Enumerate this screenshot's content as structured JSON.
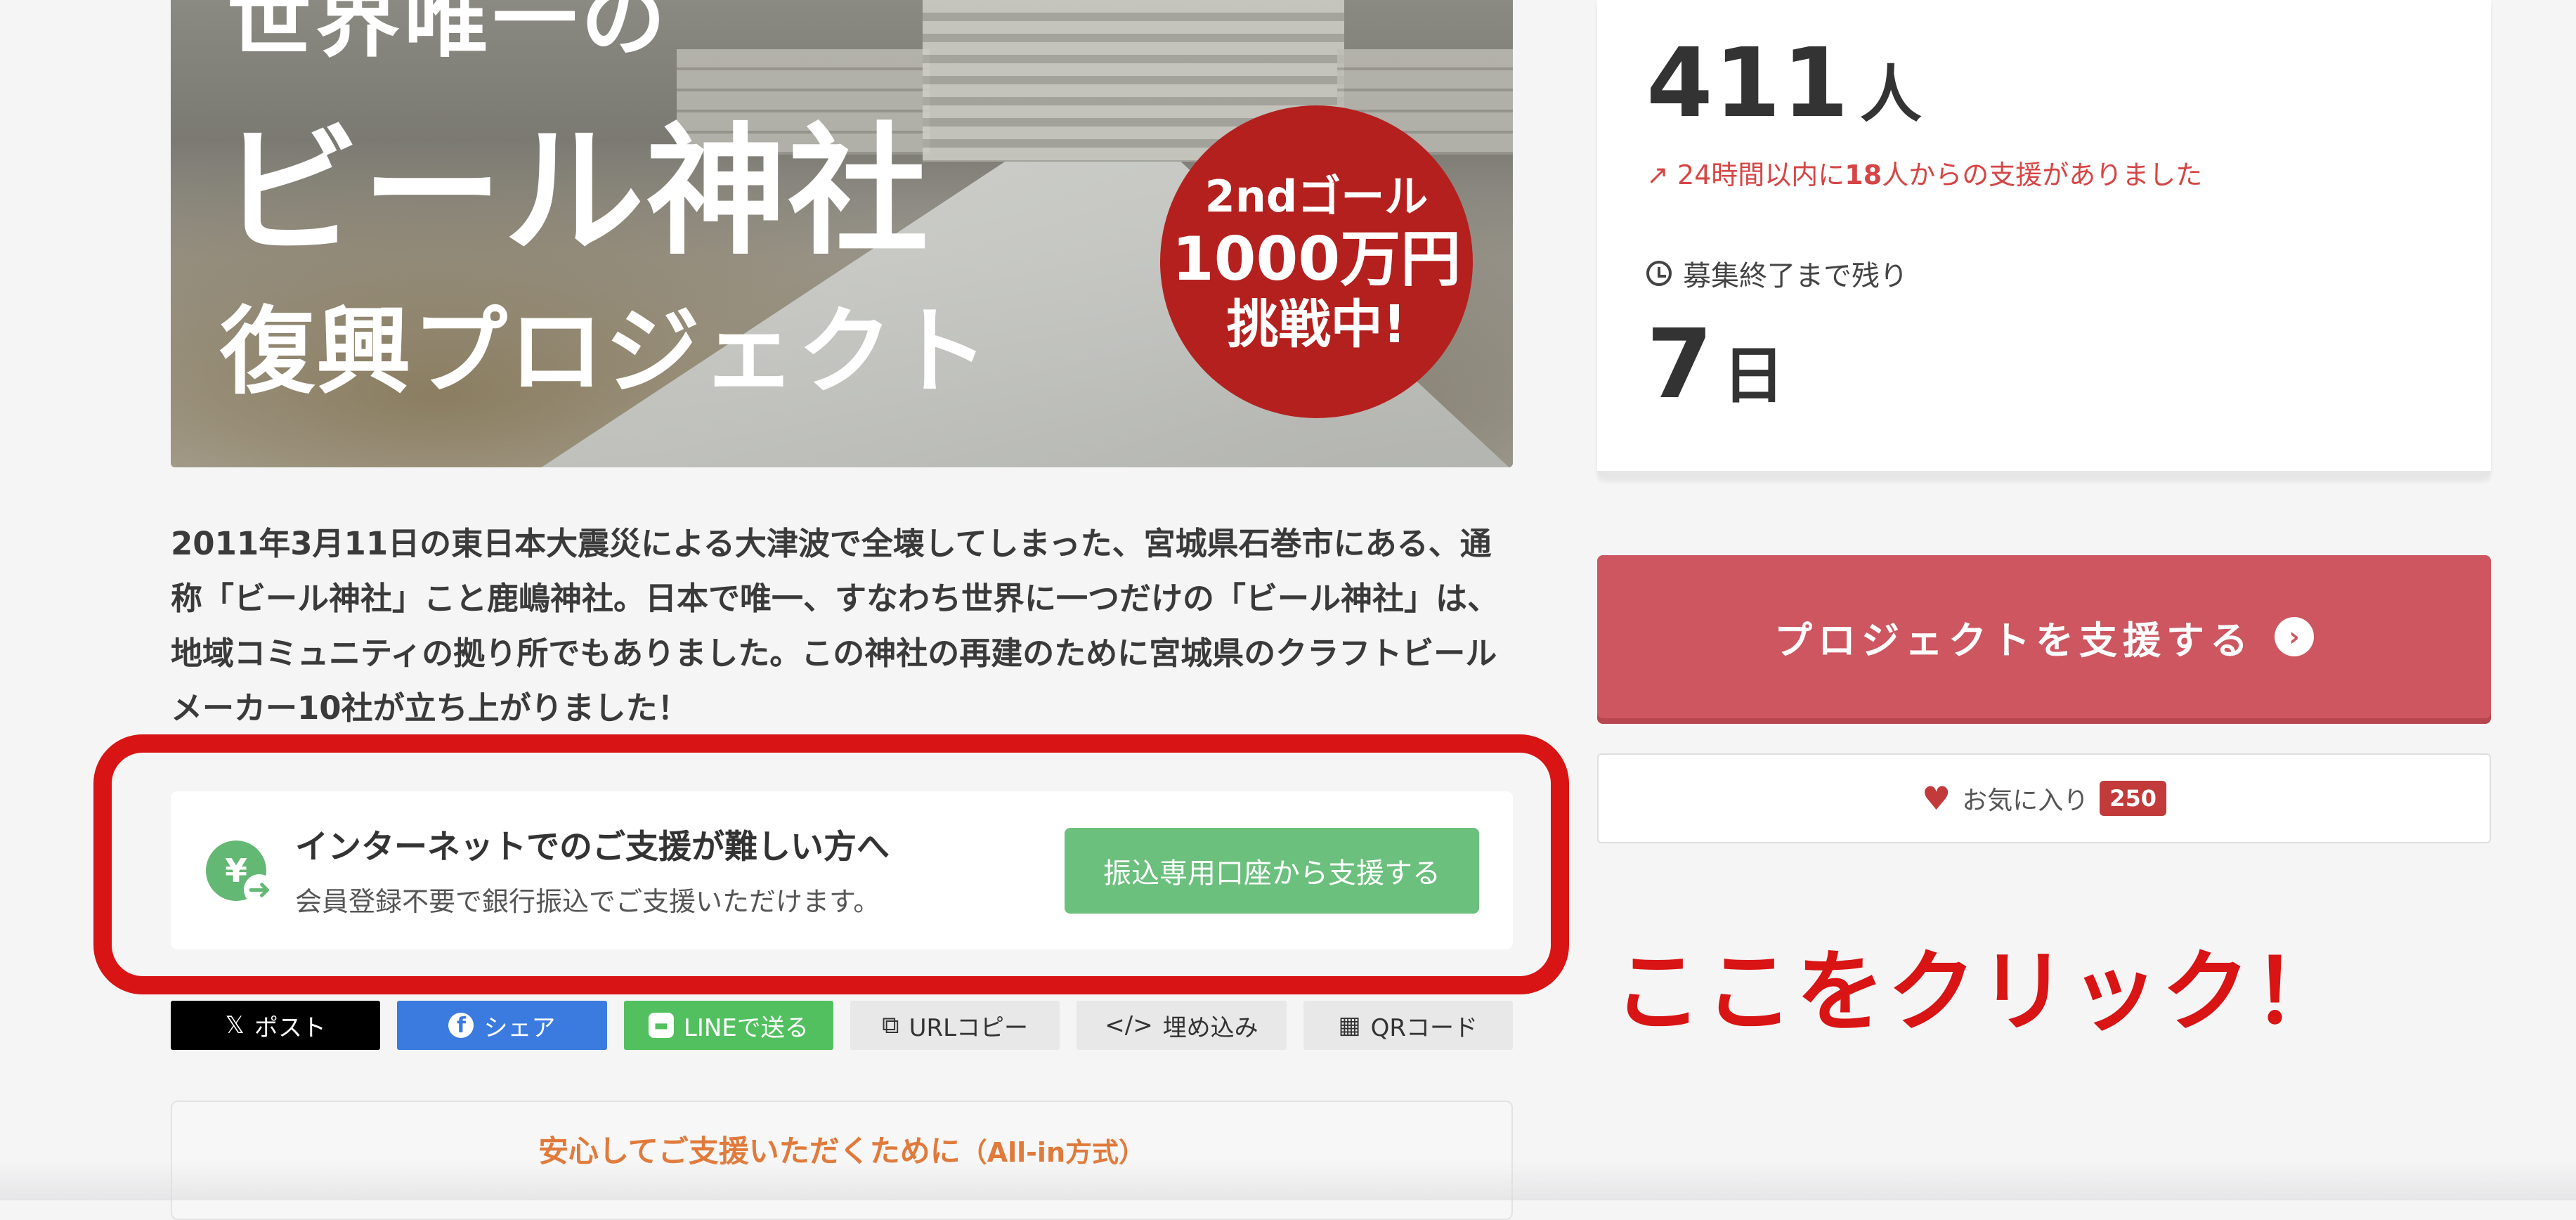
{
  "hero": {
    "title_top": "世界唯一の",
    "title_main": "ビール神社",
    "title_sub": "復興プロジェクト",
    "badge_line1": "2ndゴール",
    "badge_line2": "1000万円",
    "badge_line3": "挑戦中!"
  },
  "description": "2011年3月11日の東日本大震災による大津波で全壊してしまった、宮城県石巻市にある、通称「ビール神社」こと鹿嶋神社。日本で唯一、すなわち世界に一つだけの「ビール神社」は、地域コミュニティの拠り所でもありました。この神社の再建のために宮城県のクラフトビールメーカー10社が立ち上がりました！",
  "bank_transfer": {
    "icon": "yen-transfer-icon",
    "title": "インターネットでのご支援が難しい方へ",
    "subtitle": "会員登録不要で銀行振込でご支援いただけます。",
    "button_label": "振込専用口座から支援する"
  },
  "annotation": {
    "callout": "ここをクリック！",
    "color": "#d81414"
  },
  "share": {
    "x_label": "ポスト",
    "facebook_label": "シェア",
    "line_label": "LINEで送る",
    "url_label": "URLコピー",
    "embed_label": "埋め込み",
    "qr_label": "QRコード"
  },
  "info_box": {
    "text": "安心してご支援いただくために",
    "text_small": "（All-in方式）"
  },
  "stats": {
    "supporters": "411",
    "supporters_unit": "人",
    "trend_prefix": "24時間以内に",
    "trend_count": "18",
    "trend_suffix": "人からの支援がありました",
    "remaining_label": "募集終了まで残り",
    "days": "7",
    "days_unit": "日"
  },
  "actions": {
    "support_label": "プロジェクトを支援する",
    "favorite_label": "お気に入り",
    "favorite_count": "250"
  },
  "colors": {
    "support_button": "#cd5660",
    "bank_button": "#6cc07d",
    "trend_text": "#d64545",
    "info_text": "#e07a3b"
  }
}
